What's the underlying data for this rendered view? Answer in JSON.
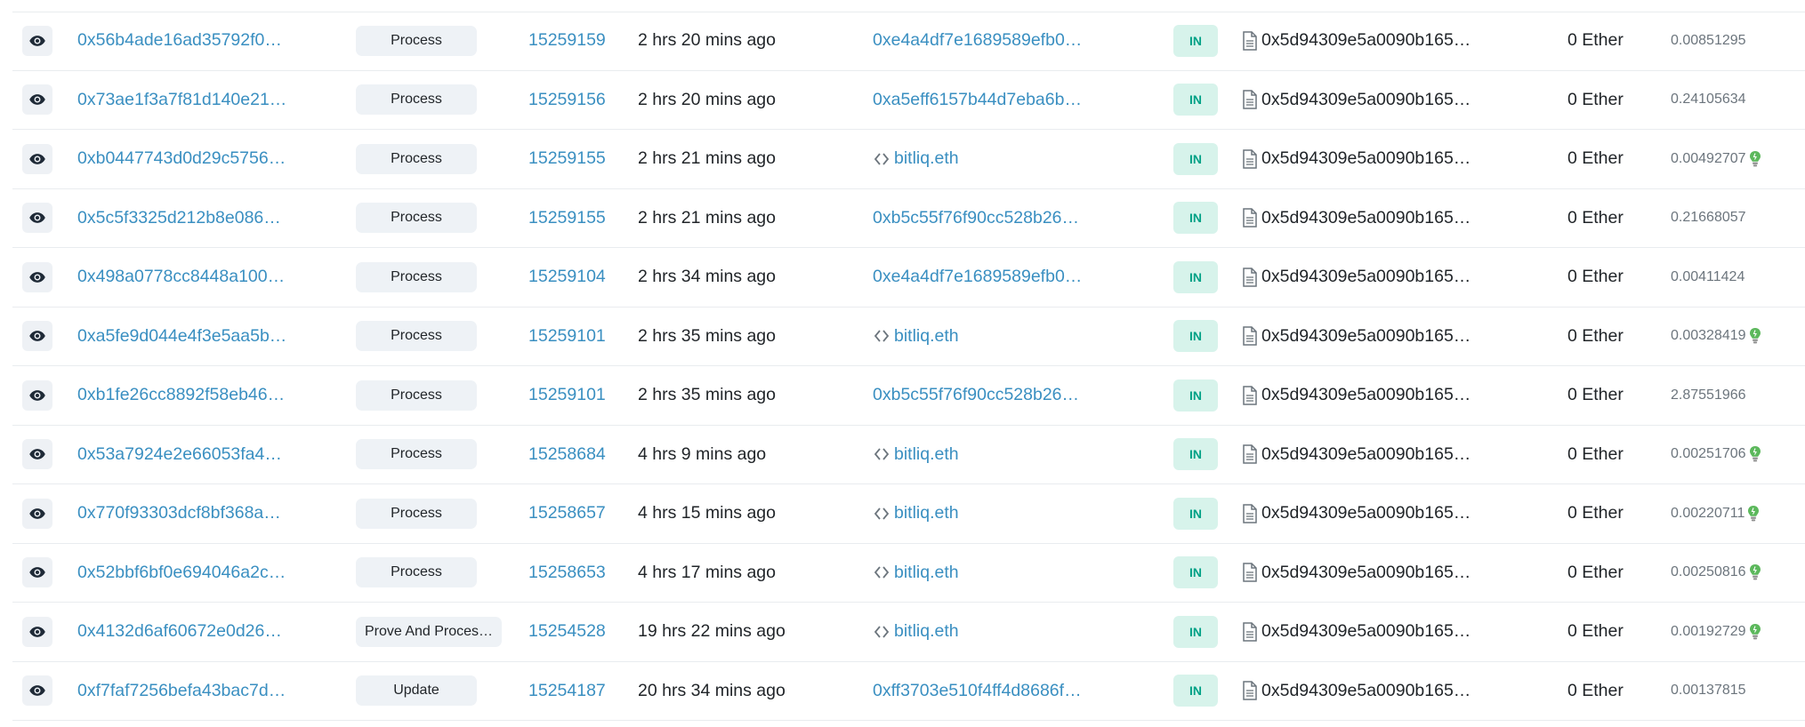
{
  "colors": {
    "link": "#3a8fc1",
    "in_badge_bg": "#d7f3eb",
    "in_badge_text": "#00a186",
    "method_bg": "#eef2f6"
  },
  "icons": {
    "view": "eye-icon",
    "ens": "ens-name-icon",
    "contract": "document-icon",
    "gas": "lightbulb-icon"
  },
  "transactions": [
    {
      "hash": "0x56b4ade16ad35792f0…",
      "method": "Process",
      "block": "15259159",
      "age": "2 hrs 20 mins ago",
      "from": "0xe4a4df7e1689589efb0…",
      "from_is_ens": false,
      "direction": "IN",
      "to": "0x5d94309e5a0090b165…",
      "value": "0 Ether",
      "fee": "0.00851295",
      "fee_icon": false
    },
    {
      "hash": "0x73ae1f3a7f81d140e21…",
      "method": "Process",
      "block": "15259156",
      "age": "2 hrs 20 mins ago",
      "from": "0xa5eff6157b44d7eba6b…",
      "from_is_ens": false,
      "direction": "IN",
      "to": "0x5d94309e5a0090b165…",
      "value": "0 Ether",
      "fee": "0.24105634",
      "fee_icon": false
    },
    {
      "hash": "0xb0447743d0d29c5756…",
      "method": "Process",
      "block": "15259155",
      "age": "2 hrs 21 mins ago",
      "from": "bitliq.eth",
      "from_is_ens": true,
      "direction": "IN",
      "to": "0x5d94309e5a0090b165…",
      "value": "0 Ether",
      "fee": "0.00492707",
      "fee_icon": true
    },
    {
      "hash": "0x5c5f3325d212b8e086…",
      "method": "Process",
      "block": "15259155",
      "age": "2 hrs 21 mins ago",
      "from": "0xb5c55f76f90cc528b26…",
      "from_is_ens": false,
      "direction": "IN",
      "to": "0x5d94309e5a0090b165…",
      "value": "0 Ether",
      "fee": "0.21668057",
      "fee_icon": false
    },
    {
      "hash": "0x498a0778cc8448a100…",
      "method": "Process",
      "block": "15259104",
      "age": "2 hrs 34 mins ago",
      "from": "0xe4a4df7e1689589efb0…",
      "from_is_ens": false,
      "direction": "IN",
      "to": "0x5d94309e5a0090b165…",
      "value": "0 Ether",
      "fee": "0.00411424",
      "fee_icon": false
    },
    {
      "hash": "0xa5fe9d044e4f3e5aa5b…",
      "method": "Process",
      "block": "15259101",
      "age": "2 hrs 35 mins ago",
      "from": "bitliq.eth",
      "from_is_ens": true,
      "direction": "IN",
      "to": "0x5d94309e5a0090b165…",
      "value": "0 Ether",
      "fee": "0.00328419",
      "fee_icon": true
    },
    {
      "hash": "0xb1fe26cc8892f58eb46…",
      "method": "Process",
      "block": "15259101",
      "age": "2 hrs 35 mins ago",
      "from": "0xb5c55f76f90cc528b26…",
      "from_is_ens": false,
      "direction": "IN",
      "to": "0x5d94309e5a0090b165…",
      "value": "0 Ether",
      "fee": "2.87551966",
      "fee_icon": false
    },
    {
      "hash": "0x53a7924e2e66053fa4…",
      "method": "Process",
      "block": "15258684",
      "age": "4 hrs 9 mins ago",
      "from": "bitliq.eth",
      "from_is_ens": true,
      "direction": "IN",
      "to": "0x5d94309e5a0090b165…",
      "value": "0 Ether",
      "fee": "0.00251706",
      "fee_icon": true
    },
    {
      "hash": "0x770f93303dcf8bf368a…",
      "method": "Process",
      "block": "15258657",
      "age": "4 hrs 15 mins ago",
      "from": "bitliq.eth",
      "from_is_ens": true,
      "direction": "IN",
      "to": "0x5d94309e5a0090b165…",
      "value": "0 Ether",
      "fee": "0.00220711",
      "fee_icon": true
    },
    {
      "hash": "0x52bbf6bf0e694046a2c…",
      "method": "Process",
      "block": "15258653",
      "age": "4 hrs 17 mins ago",
      "from": "bitliq.eth",
      "from_is_ens": true,
      "direction": "IN",
      "to": "0x5d94309e5a0090b165…",
      "value": "0 Ether",
      "fee": "0.00250816",
      "fee_icon": true
    },
    {
      "hash": "0x4132d6af60672e0d26…",
      "method": "Prove And Proces…",
      "block": "15254528",
      "age": "19 hrs 22 mins ago",
      "from": "bitliq.eth",
      "from_is_ens": true,
      "direction": "IN",
      "to": "0x5d94309e5a0090b165…",
      "value": "0 Ether",
      "fee": "0.00192729",
      "fee_icon": true
    },
    {
      "hash": "0xf7faf7256befa43bac7d…",
      "method": "Update",
      "block": "15254187",
      "age": "20 hrs 34 mins ago",
      "from": "0xff3703e510f4ff4d8686f…",
      "from_is_ens": false,
      "direction": "IN",
      "to": "0x5d94309e5a0090b165…",
      "value": "0 Ether",
      "fee": "0.00137815",
      "fee_icon": false
    }
  ]
}
